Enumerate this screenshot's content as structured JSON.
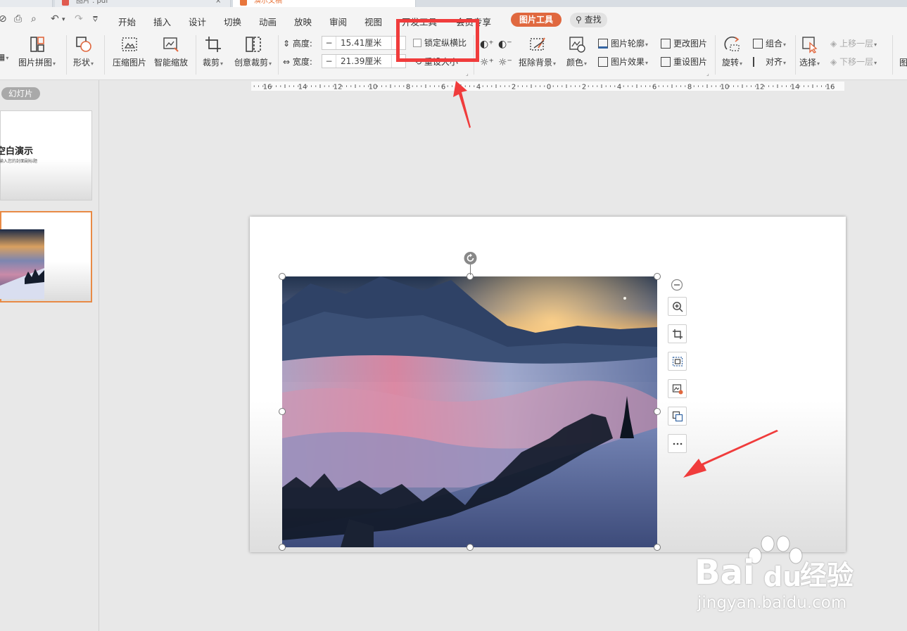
{
  "titlebar": {
    "tabs": [
      {
        "label": ""
      },
      {
        "label": "图片 . pdf",
        "close": "×"
      },
      {
        "label": "演示文稿"
      }
    ]
  },
  "menu": {
    "items": [
      "开始",
      "插入",
      "设计",
      "切换",
      "动画",
      "放映",
      "审阅",
      "视图",
      "开发工具",
      "会员专享"
    ],
    "context_tab": "图片工具",
    "search": "查找",
    "accent_color": "#e0683f"
  },
  "ribbon": {
    "picture_collage": "图片拼图",
    "shape": "形状",
    "compress": "压缩图片",
    "smart_zoom": "智能缩放",
    "crop": "裁剪",
    "creative_crop": "创意裁剪",
    "height_label": "高度:",
    "height_value": "15.41厘米",
    "width_label": "宽度:",
    "width_value": "21.39厘米",
    "lock_ratio": "锁定纵横比",
    "reset_size": "重设大小",
    "remove_bg": "抠除背景",
    "color": "颜色",
    "outline": "图片轮廓",
    "effect": "图片效果",
    "change_pic": "更改图片",
    "reset_pic": "重设图片",
    "rotate": "旋转",
    "group": "组合",
    "align": "对齐",
    "select": "选择",
    "bring_forward": "上移一层",
    "send_backward": "下移一层",
    "more_cut": "图"
  },
  "left_panel": {
    "slides_tag": "幻灯片",
    "slide1_title": "空白演示",
    "slide1_subtitle": "输入您的封面副标题"
  },
  "ruler": {
    "labels": [
      "16",
      "14",
      "12",
      "10",
      "8",
      "6",
      "4",
      "2",
      "0",
      "2",
      "4",
      "6",
      "8",
      "10",
      "12",
      "14",
      "16"
    ]
  },
  "watermark": {
    "brand": "Bai",
    "brand2": "du",
    "cn": "经验",
    "url": "jingyan.baidu.com"
  },
  "annotation_color": "#f03c3c"
}
